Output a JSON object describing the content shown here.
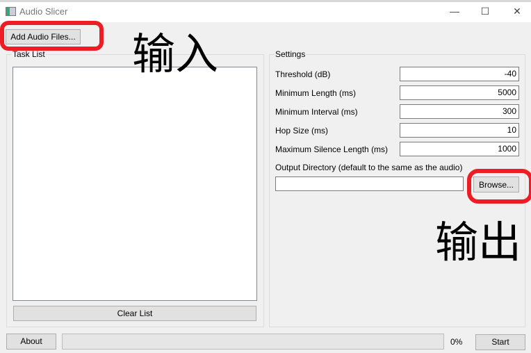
{
  "window": {
    "title": "Audio Slicer",
    "minimize": "—",
    "maximize": "☐",
    "close": "✕"
  },
  "toolbar": {
    "add_files": "Add Audio Files..."
  },
  "task_list": {
    "title": "Task List",
    "clear": "Clear List"
  },
  "settings": {
    "title": "Settings",
    "fields": [
      {
        "label": "Threshold (dB)",
        "value": "-40"
      },
      {
        "label": "Minimum Length (ms)",
        "value": "5000"
      },
      {
        "label": "Minimum Interval (ms)",
        "value": "300"
      },
      {
        "label": "Hop Size (ms)",
        "value": "10"
      },
      {
        "label": "Maximum Silence Length (ms)",
        "value": "1000"
      }
    ],
    "output_label": "Output Directory (default to the same as the audio)",
    "output_value": "",
    "browse": "Browse..."
  },
  "footer": {
    "about": "About",
    "progress": "0%",
    "progress_value": 0,
    "start": "Start"
  },
  "annotations": {
    "input": "输入",
    "output": "输出",
    "color": "#ee1c25"
  }
}
